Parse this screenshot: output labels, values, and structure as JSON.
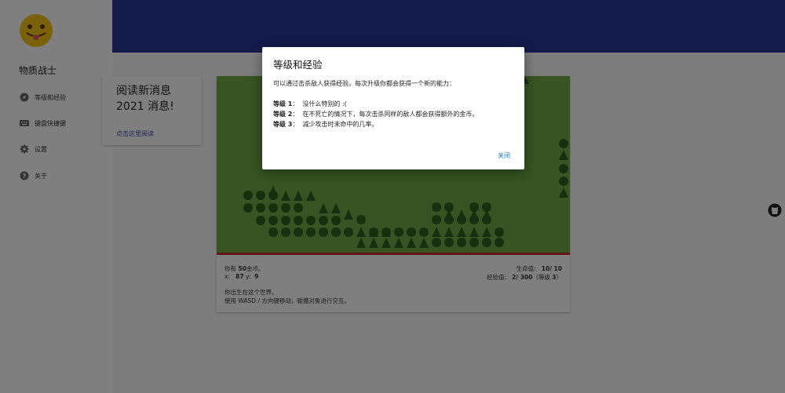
{
  "app": {
    "name": "物质战士",
    "avatar_icon": "tongue-emoji-icon"
  },
  "sidebar": {
    "items": [
      {
        "label": "等级和经验",
        "icon": "compass-icon"
      },
      {
        "label": "键盘快捷键",
        "icon": "keyboard-icon"
      },
      {
        "label": "设置",
        "icon": "gear-icon"
      },
      {
        "label": "关于",
        "icon": "help-icon"
      }
    ]
  },
  "news": {
    "title": "阅读新消息\n2021 消息!",
    "link": "点击这里阅读"
  },
  "game": {
    "gold_prefix": "你有 ",
    "gold_value": "50",
    "gold_suffix": "金币。",
    "x_label": "x:",
    "x_value": "87",
    "y_label": "y:",
    "y_value": "9",
    "hp_label": "生命值:",
    "hp_value": "10/ 10",
    "xp_label": "经验值:",
    "xp_value": "2/ 300",
    "level_prefix": "（等级 ",
    "level_value": "3",
    "level_suffix": "）",
    "message1": "你出生在这个世界。",
    "message2": "使用 WASD / 方向键移动，碰撞对象进行交互。"
  },
  "dialog": {
    "title": "等级和经验",
    "intro": "可以通过击杀敌人获得经验。每次升级你都会获得一个新的能力：",
    "levels": [
      {
        "label": "等级 1",
        "text": "没什么特别的 :("
      },
      {
        "label": "等级 2",
        "text": "在不死亡的情况下，每次击杀同样的敌人都会获得额外的金币。"
      },
      {
        "label": "等级 3",
        "text": "减少攻击时未命中的几率。"
      }
    ],
    "close_label": "关闭"
  },
  "colors": {
    "topbar": "#283593",
    "field": "#6fa844",
    "tree": "#2e5e1e",
    "danger_line": "#c62828",
    "link": "#1976d2"
  }
}
